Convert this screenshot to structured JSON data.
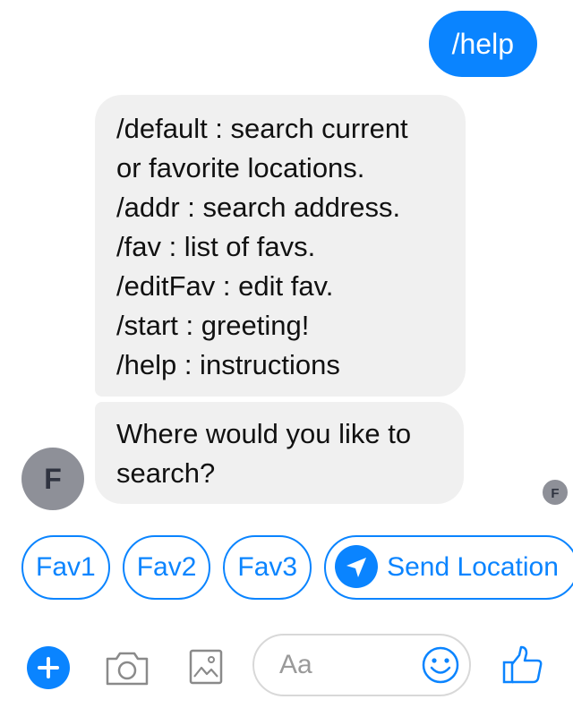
{
  "conversation": {
    "outgoing": {
      "text": "/help"
    },
    "incoming": [
      {
        "lines": [
          "/default : search current",
          "or favorite locations.",
          "/addr : search address.",
          "/fav : list of favs.",
          "/editFav : edit fav.",
          "/start : greeting!",
          "/help : instructions"
        ]
      },
      {
        "lines": [
          "Where would you like to",
          "search?"
        ]
      }
    ],
    "sender_avatar_initial": "F",
    "seen_avatar_initial": "F"
  },
  "quick_replies": [
    {
      "label": "Fav1"
    },
    {
      "label": "Fav2"
    },
    {
      "label": "Fav3"
    },
    {
      "label": "Send Location",
      "icon": "location-arrow-icon"
    }
  ],
  "composer": {
    "placeholder": "Aa",
    "icons": [
      "plus-icon",
      "camera-icon",
      "image-icon",
      "emoji-icon",
      "thumbs-up-icon"
    ]
  },
  "colors": {
    "accent": "#0a84ff",
    "incoming_bubble": "#f0f0f0",
    "avatar": "#8e9098"
  }
}
